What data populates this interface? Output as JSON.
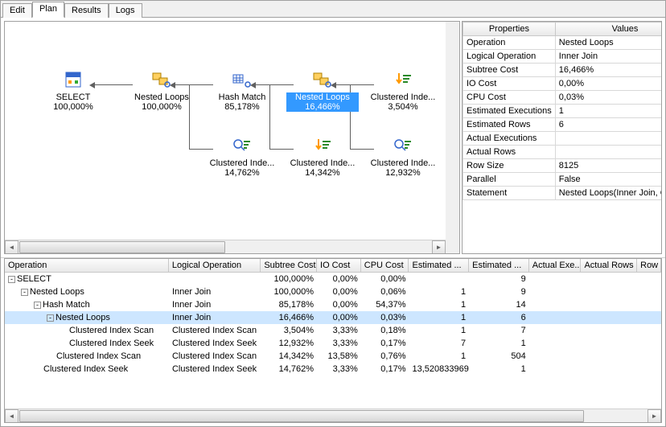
{
  "tabs": {
    "edit": "Edit",
    "plan": "Plan",
    "results": "Results",
    "logs": "Logs"
  },
  "plan_nodes": {
    "select": {
      "label": "SELECT",
      "pct": "100,000%"
    },
    "nl1": {
      "label": "Nested Loops",
      "pct": "100,000%"
    },
    "hash": {
      "label": "Hash Match",
      "pct": "85,178%"
    },
    "nl2": {
      "label": "Nested Loops",
      "pct": "16,466%"
    },
    "ciscan1": {
      "label": "Clustered Inde...",
      "pct": "3,504%"
    },
    "ciseek1": {
      "label": "Clustered Inde...",
      "pct": "14,762%"
    },
    "ciscan2": {
      "label": "Clustered Inde...",
      "pct": "14,342%"
    },
    "ciseek2": {
      "label": "Clustered Inde...",
      "pct": "12,932%"
    }
  },
  "props_header": {
    "col1": "Properties",
    "col2": "Values"
  },
  "props": [
    {
      "k": "Operation",
      "v": "Nested Loops"
    },
    {
      "k": "Logical Operation",
      "v": "Inner Join"
    },
    {
      "k": "Subtree Cost",
      "v": "16,466%"
    },
    {
      "k": "IO Cost",
      "v": "0,00%"
    },
    {
      "k": "CPU Cost",
      "v": "0,03%"
    },
    {
      "k": "Estimated Executions",
      "v": "1"
    },
    {
      "k": "Estimated Rows",
      "v": "6"
    },
    {
      "k": "Actual Executions",
      "v": ""
    },
    {
      "k": "Actual Rows",
      "v": ""
    },
    {
      "k": "Row Size",
      "v": "8125"
    },
    {
      "k": "Parallel",
      "v": "False"
    },
    {
      "k": "Statement",
      "v": "Nested Loops(Inner Join, OUTER"
    }
  ],
  "grid_cols": {
    "op": "Operation",
    "log": "Logical Operation",
    "sub": "Subtree Cost",
    "io": "IO Cost",
    "cpu": "CPU Cost",
    "est1": "Estimated ...",
    "est2": "Estimated ...",
    "act1": "Actual Exe...",
    "act2": "Actual Rows",
    "row": "Row"
  },
  "grid_rows": [
    {
      "indent": 0,
      "toggle": "-",
      "op": "SELECT",
      "log": "",
      "sub": "100,000%",
      "io": "0,00%",
      "cpu": "0,00%",
      "est1": "",
      "est2": "9",
      "sel": false
    },
    {
      "indent": 1,
      "toggle": "-",
      "op": "Nested Loops",
      "log": "Inner Join",
      "sub": "100,000%",
      "io": "0,00%",
      "cpu": "0,06%",
      "est1": "1",
      "est2": "9",
      "sel": false
    },
    {
      "indent": 2,
      "toggle": "-",
      "op": "Hash Match",
      "log": "Inner Join",
      "sub": "85,178%",
      "io": "0,00%",
      "cpu": "54,37%",
      "est1": "1",
      "est2": "14",
      "sel": false
    },
    {
      "indent": 3,
      "toggle": "-",
      "op": "Nested Loops",
      "log": "Inner Join",
      "sub": "16,466%",
      "io": "0,00%",
      "cpu": "0,03%",
      "est1": "1",
      "est2": "6",
      "sel": true
    },
    {
      "indent": 4,
      "toggle": "",
      "op": "Clustered Index Scan",
      "log": "Clustered Index Scan",
      "sub": "3,504%",
      "io": "3,33%",
      "cpu": "0,18%",
      "est1": "1",
      "est2": "7",
      "sel": false
    },
    {
      "indent": 4,
      "toggle": "",
      "op": "Clustered Index Seek",
      "log": "Clustered Index Seek",
      "sub": "12,932%",
      "io": "3,33%",
      "cpu": "0,17%",
      "est1": "7",
      "est2": "1",
      "sel": false
    },
    {
      "indent": 3,
      "toggle": "",
      "op": "Clustered Index Scan",
      "log": "Clustered Index Scan",
      "sub": "14,342%",
      "io": "13,58%",
      "cpu": "0,76%",
      "est1": "1",
      "est2": "504",
      "sel": false
    },
    {
      "indent": 2,
      "toggle": "",
      "op": "Clustered Index Seek",
      "log": "Clustered Index Seek",
      "sub": "14,762%",
      "io": "3,33%",
      "cpu": "0,17%",
      "est1": "13,520833969",
      "est2": "1",
      "sel": false
    }
  ]
}
